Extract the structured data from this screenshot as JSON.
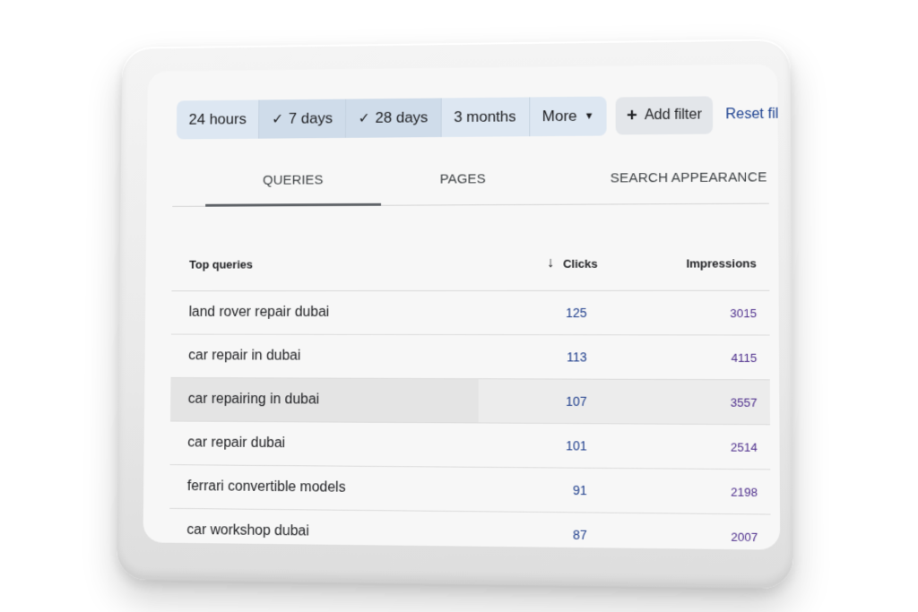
{
  "filters": {
    "ranges": [
      {
        "label": "24 hours",
        "selected": false
      },
      {
        "label": "7 days",
        "selected": true
      },
      {
        "label": "28 days",
        "selected": true
      },
      {
        "label": "3 months",
        "selected": false
      }
    ],
    "more_label": "More",
    "add_filter_label": "Add filter",
    "reset_label": "Reset filters"
  },
  "tabs": [
    {
      "label": "QUERIES",
      "active": true
    },
    {
      "label": "PAGES",
      "active": false
    },
    {
      "label": "SEARCH APPEARANCE",
      "active": false
    }
  ],
  "table": {
    "headers": {
      "query": "Top queries",
      "clicks": "Clicks",
      "impressions": "Impressions"
    },
    "rows": [
      {
        "query": "land rover repair dubai",
        "clicks": "125",
        "impressions": "3015"
      },
      {
        "query": "car repair in dubai",
        "clicks": "113",
        "impressions": "4115"
      },
      {
        "query": "car repairing in dubai",
        "clicks": "107",
        "impressions": "3557"
      },
      {
        "query": "car repair dubai",
        "clicks": "101",
        "impressions": "2514"
      },
      {
        "query": "ferrari convertible models",
        "clicks": "91",
        "impressions": "2198"
      },
      {
        "query": "car workshop dubai",
        "clicks": "87",
        "impressions": "2007"
      }
    ]
  },
  "colors": {
    "accent_link": "#1a3f8f",
    "clicks": "#1a3a8a",
    "impressions": "#4a2a8a",
    "chip_bg": "#dde7f2"
  },
  "icons": {
    "check": "check-icon",
    "caret": "caret-down-icon",
    "plus": "plus-icon",
    "sort": "arrow-down-icon"
  }
}
